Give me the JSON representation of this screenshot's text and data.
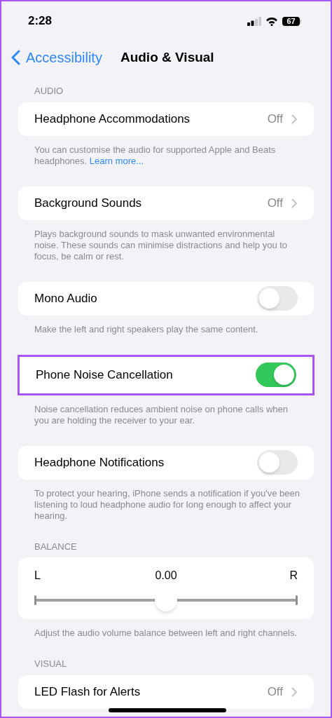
{
  "status_bar": {
    "time": "2:28",
    "battery": "67"
  },
  "nav": {
    "back": "Accessibility",
    "title": "Audio & Visual"
  },
  "groups": [
    {
      "header": "AUDIO",
      "row": {
        "kind": "disclosure",
        "label": "Headphone Accommodations",
        "value": "Off",
        "highlighted": false
      },
      "footer": "You can customise the audio for supported Apple and Beats headphones.",
      "link": "Learn more..."
    },
    {
      "row": {
        "kind": "disclosure",
        "label": "Background Sounds",
        "value": "Off",
        "highlighted": false
      },
      "footer": "Plays background sounds to mask unwanted environmental noise. These sounds can minimise distractions and help you to focus, be calm or rest."
    },
    {
      "row": {
        "kind": "toggle",
        "label": "Mono Audio",
        "on": false,
        "highlighted": false
      },
      "footer": "Make the left and right speakers play the same content."
    },
    {
      "row": {
        "kind": "toggle",
        "label": "Phone Noise Cancellation",
        "on": true,
        "highlighted": true
      },
      "footer": "Noise cancellation reduces ambient noise on phone calls when you are holding the receiver to your ear."
    },
    {
      "row": {
        "kind": "toggle",
        "label": "Headphone Notifications",
        "on": false,
        "highlighted": false
      },
      "footer": "To protect your hearing, iPhone sends a notification if you've been listening to loud headphone audio for long enough to affect your hearing."
    },
    {
      "header": "BALANCE",
      "row": {
        "kind": "slider",
        "left": "L",
        "reading": "0.00",
        "right": "R",
        "level": 0.5,
        "highlighted": false
      },
      "footer": "Adjust the audio volume balance between left and right channels."
    },
    {
      "header": "VISUAL",
      "row": {
        "kind": "disclosure",
        "label": "LED Flash for Alerts",
        "value": "Off",
        "highlighted": false
      }
    }
  ]
}
